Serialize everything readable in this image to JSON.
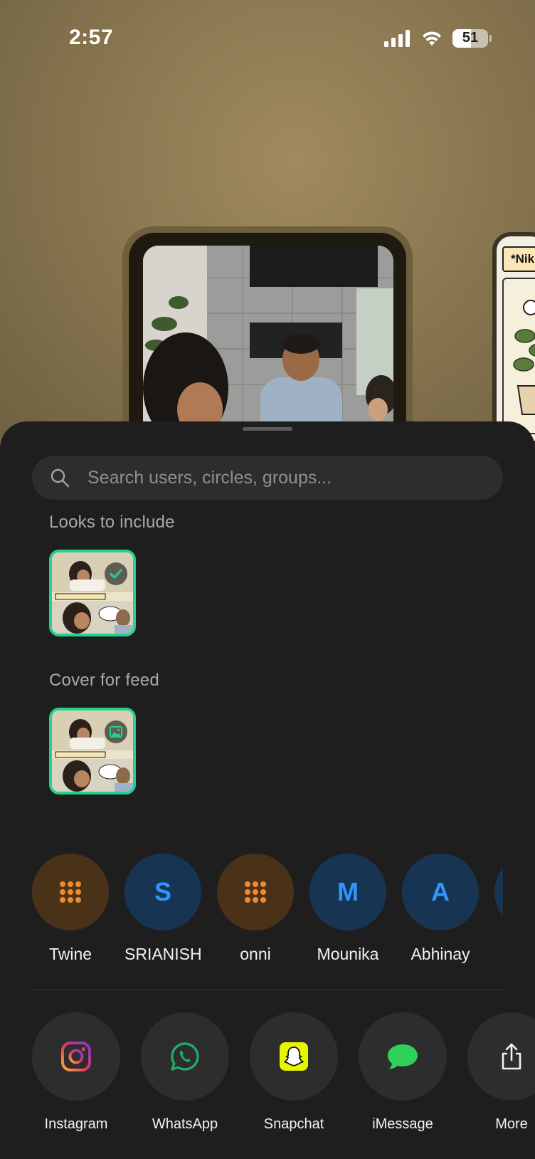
{
  "status_bar": {
    "time": "2:57",
    "battery": "51"
  },
  "background_card": {
    "side_label": "*Nik"
  },
  "sheet": {
    "search": {
      "placeholder": "Search users, circles, groups..."
    },
    "looks_section": {
      "title": "Looks to include",
      "selected": true
    },
    "cover_section": {
      "title": "Cover for feed"
    },
    "contacts": [
      {
        "name": "Twine",
        "kind": "grid",
        "avatar_bg": "#4a3218",
        "accent": "#f08a2c"
      },
      {
        "name": "SRIANISH",
        "initial": "S",
        "kind": "initial",
        "avatar_bg": "#173553",
        "accent": "#2f95ff"
      },
      {
        "name": "onni",
        "kind": "grid",
        "avatar_bg": "#4a3218",
        "accent": "#f08a2c"
      },
      {
        "name": "Mounika",
        "initial": "M",
        "kind": "initial",
        "avatar_bg": "#173553",
        "accent": "#2f95ff"
      },
      {
        "name": "Abhinay",
        "initial": "A",
        "kind": "initial",
        "avatar_bg": "#173553",
        "accent": "#2f95ff"
      }
    ],
    "share_apps": [
      {
        "label": "Instagram",
        "icon": "instagram-icon"
      },
      {
        "label": "WhatsApp",
        "icon": "whatsapp-icon"
      },
      {
        "label": "Snapchat",
        "icon": "snapchat-icon"
      },
      {
        "label": "iMessage",
        "icon": "imessage-icon"
      },
      {
        "label": "More",
        "icon": "share-icon"
      }
    ],
    "accent_color": "#23d190"
  }
}
